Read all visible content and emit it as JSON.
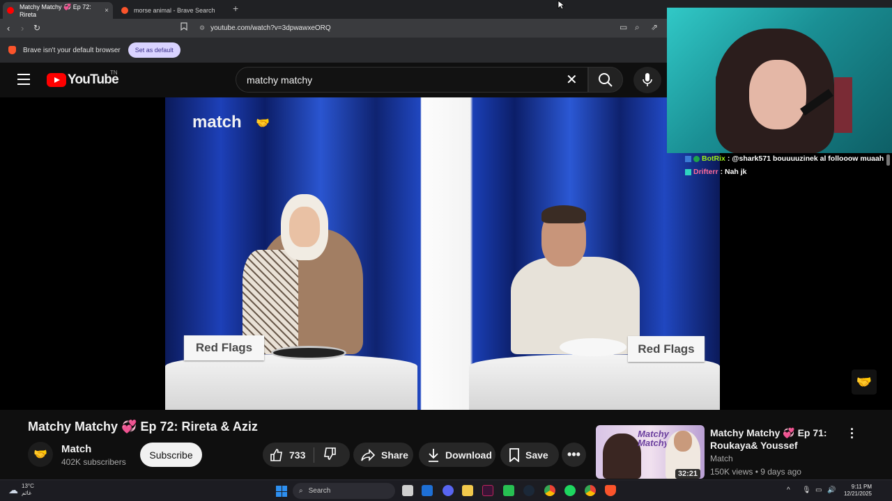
{
  "browser": {
    "tabs": [
      {
        "label": "Matchy Matchy 💞 Ep 72: Rireta",
        "close": "×",
        "active": true,
        "favicon_color": "#ff0000"
      },
      {
        "label": "morse animal - Brave Search",
        "active": false,
        "favicon_color": "#fb542b"
      }
    ],
    "new_tab": "+",
    "url": "youtube.com/watch?v=3dpwawxeORQ",
    "infobar": {
      "text": "Brave isn't your default browser",
      "button": "Set as default"
    }
  },
  "youtube": {
    "logo_text": "YouTube",
    "region": "TN",
    "search_value": "matchy matchy",
    "video": {
      "brand": "match",
      "sign_left": "Red Flags",
      "sign_right": "Red Flags"
    },
    "title": "Matchy Matchy 💞 Ep 72: Rireta & Aziz",
    "channel": {
      "name": "Match",
      "subscribers": "402K subscribers"
    },
    "subscribe": "Subscribe",
    "likes": "733",
    "share": "Share",
    "download": "Download",
    "save": "Save",
    "related": {
      "title": "Matchy Matchy 💞 Ep 71: Roukaya& Youssef",
      "channel": "Match",
      "meta": "150K views • 9 days ago",
      "duration": "32:21",
      "thumb_text": "Matchy Matchy"
    }
  },
  "stream_chat": [
    {
      "user": "BotRix",
      "message": ": @shark571 bouuuuzinek al follooow muaah",
      "color": "#9ef01a"
    },
    {
      "user": "Drifterr",
      "message": ": Nah jk",
      "color": "#ff6b9a"
    }
  ],
  "taskbar": {
    "weather_temp": "13°C",
    "weather_desc": "غائم",
    "search": "Search",
    "time": "9:11 PM",
    "date": "12/21/2025"
  }
}
